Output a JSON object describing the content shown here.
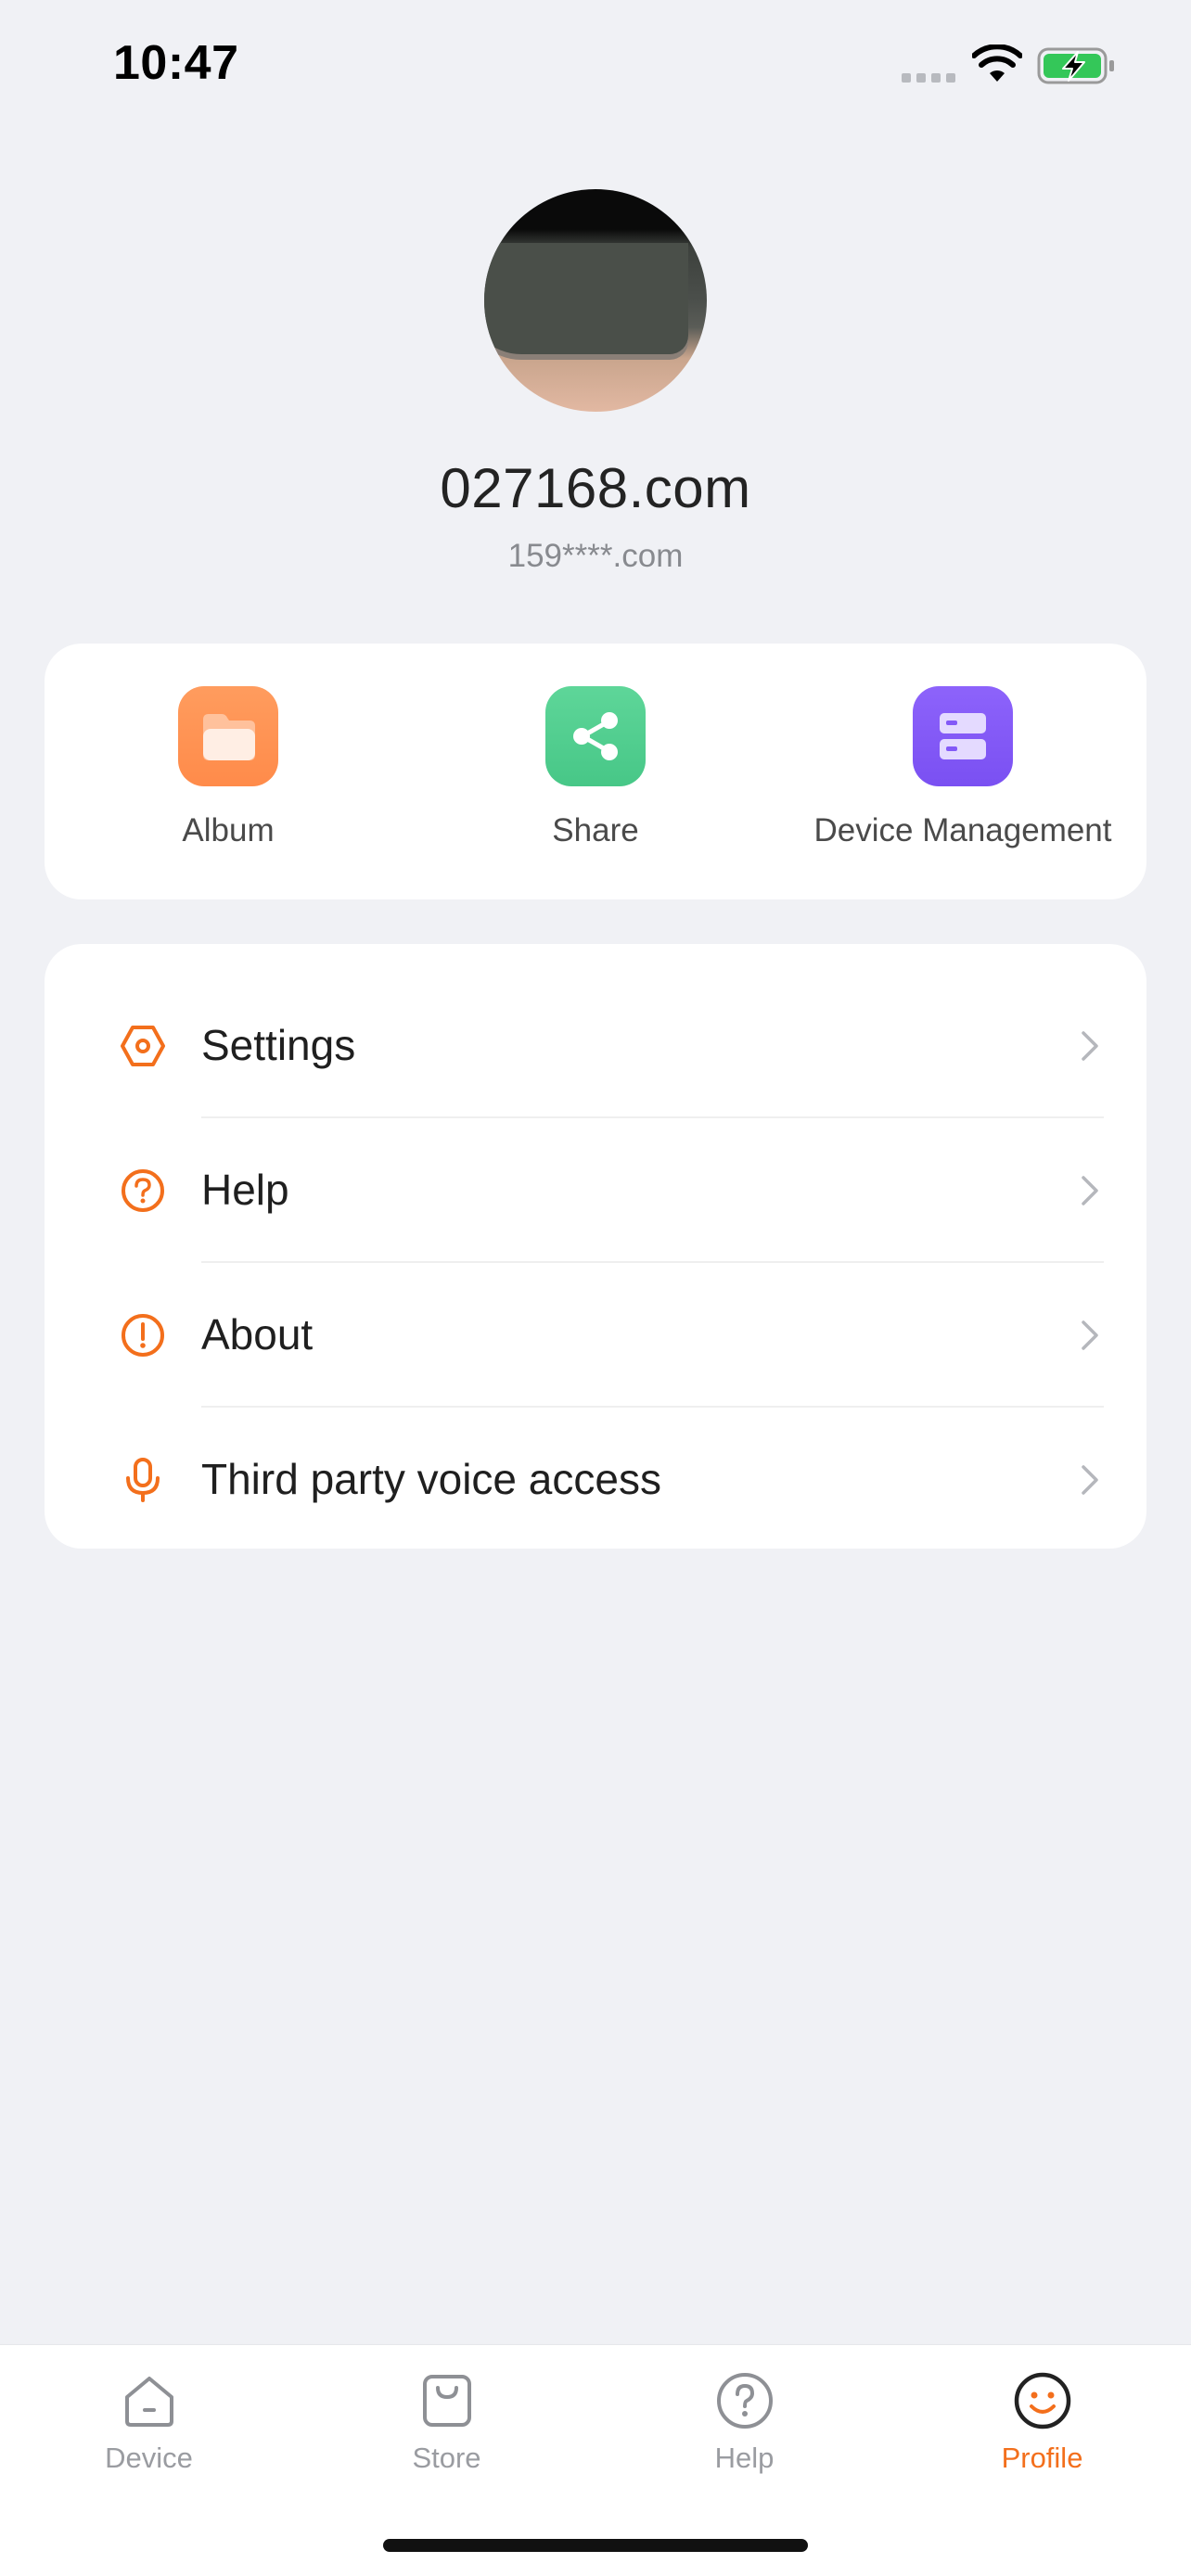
{
  "status_bar": {
    "time": "10:47",
    "battery_status": "charging"
  },
  "profile": {
    "name": "027168.com",
    "email": "159****.com"
  },
  "shortcuts": [
    {
      "label": "Album",
      "icon": "folder-icon",
      "color": "#FF9150"
    },
    {
      "label": "Share",
      "icon": "share-icon",
      "color": "#50CF8E"
    },
    {
      "label": "Device Management",
      "icon": "server-icon",
      "color": "#8359F7"
    }
  ],
  "menu": [
    {
      "label": "Settings",
      "icon": "settings-hexagon-icon"
    },
    {
      "label": "Help",
      "icon": "help-circle-icon"
    },
    {
      "label": "About",
      "icon": "info-exclamation-icon"
    },
    {
      "label": "Third party voice access",
      "icon": "microphone-icon"
    }
  ],
  "tabs": [
    {
      "label": "Device",
      "icon": "home-icon",
      "active": false
    },
    {
      "label": "Store",
      "icon": "shopping-bag-icon",
      "active": false
    },
    {
      "label": "Help",
      "icon": "help-circle-icon",
      "active": false
    },
    {
      "label": "Profile",
      "icon": "smiley-face-icon",
      "active": true
    }
  ],
  "colors": {
    "accent": "#F36F1C",
    "background": "#F0F1F5",
    "card": "#FFFFFF",
    "inactive_tab": "#9A9CA1"
  }
}
